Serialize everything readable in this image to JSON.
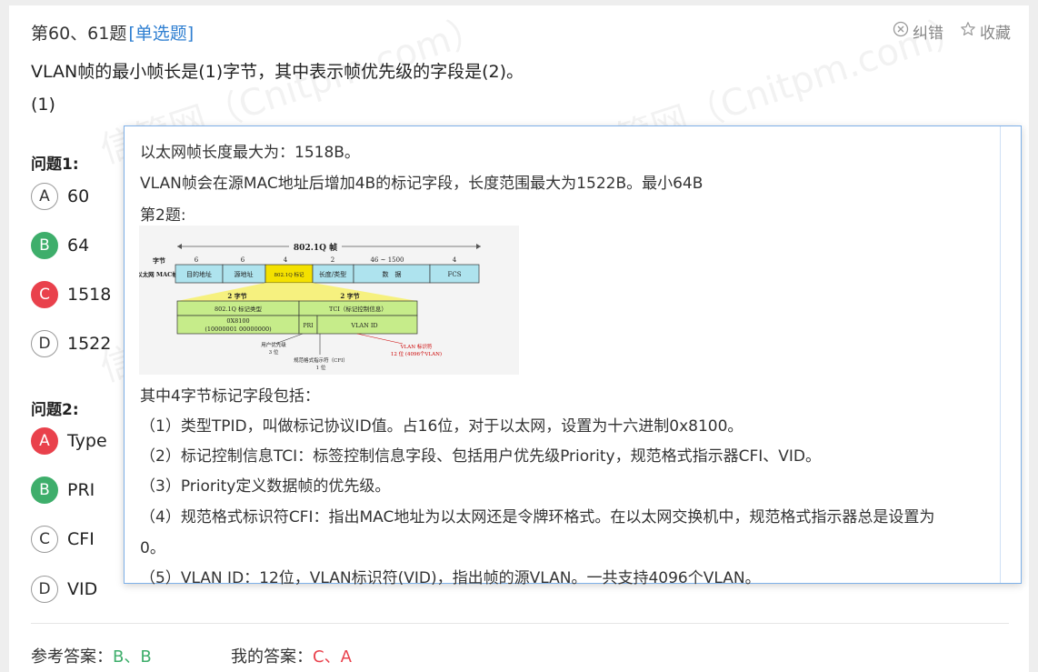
{
  "header": {
    "title": "第60、61题",
    "type_tag": "[单选题]",
    "report_label": "纠错",
    "favorite_label": "收藏"
  },
  "question": {
    "text": "VLAN帧的最小帧长是(1)字节，其中表示帧优先级的字段是(2)。",
    "sub_label": "(1)"
  },
  "q1": {
    "label": "问题1:",
    "options": [
      {
        "letter": "A",
        "text": "60",
        "state": "none"
      },
      {
        "letter": "B",
        "text": "64",
        "state": "correct"
      },
      {
        "letter": "C",
        "text": "1518",
        "state": "wrong"
      },
      {
        "letter": "D",
        "text": "1522",
        "state": "none"
      }
    ]
  },
  "q2": {
    "label": "问题2:",
    "options": [
      {
        "letter": "A",
        "text": "Type",
        "state": "wrong"
      },
      {
        "letter": "B",
        "text": "PRI",
        "state": "correct"
      },
      {
        "letter": "C",
        "text": "CFI",
        "state": "none"
      },
      {
        "letter": "D",
        "text": "VID",
        "state": "none"
      }
    ]
  },
  "explanation": {
    "l1": "以太网帧长度最大为：1518B。",
    "l2": "VLAN帧会在源MAC地址后增加4B的标记字段，长度范围最大为1522B。最小64B",
    "l3": "第2题:",
    "l4": "其中4字节标记字段包括：",
    "l5": "（1）类型TPID，叫做标记协议ID值。占16位，对于以太网，设置为十六进制0x8100。",
    "l6": "（2）标记控制信息TCI：标签控制信息字段、包括用户优先级Priority，规范格式指示器CFI、VID。",
    "l7": "（3）Priority定义数据帧的优先级。",
    "l8": "（4）规范格式标识符CFI：指出MAC地址为以太网还是令牌环格式。在以太网交换机中，规范格式指示器总是设置为",
    "l9": "0。",
    "l10": "（5）VLAN ID：12位，VLAN标识符(VID)，指出帧的源VLAN。一共支持4096个VLAN。"
  },
  "diagram": {
    "title": "802.1Q 帧",
    "row_label_bytes": "字节",
    "row_label_frame": "以太网 MAC帧",
    "bytes": [
      "6",
      "6",
      "4",
      "2",
      "46 ~ 1500",
      "4"
    ],
    "fields": [
      "目的地址",
      "源地址",
      "802.1Q 标记",
      "长度/类型",
      "数　据",
      "FCS"
    ],
    "left_bytes": "2 字节",
    "right_bytes": "2 字节",
    "tpid_label": "802.1Q 标记类型",
    "tci_label": "TCI（标记控制信息）",
    "tpid_value": "0X8100",
    "tpid_bits": "(10000001 00000000)",
    "pri": "PRI",
    "vid": "VLAN ID",
    "note_priority": "用户优先级",
    "note_priority_bits": "3 位",
    "note_cfi": "规范格式指示符（CFI）",
    "note_cfi_bits": "1 位",
    "note_vid": "VLAN 标识符",
    "note_vid_bits": "12 位 (4096个VLAN)"
  },
  "footer": {
    "ref_label": "参考答案：",
    "ref_value": "B、B",
    "my_label": "我的答案：",
    "my_value": "C、A"
  },
  "watermark": "信管网（Cnitpm.com）",
  "colors": {
    "correct": "#3eae6b",
    "wrong": "#e9414c",
    "link": "#2f7fd1",
    "popup_border": "#7eb0e8"
  }
}
